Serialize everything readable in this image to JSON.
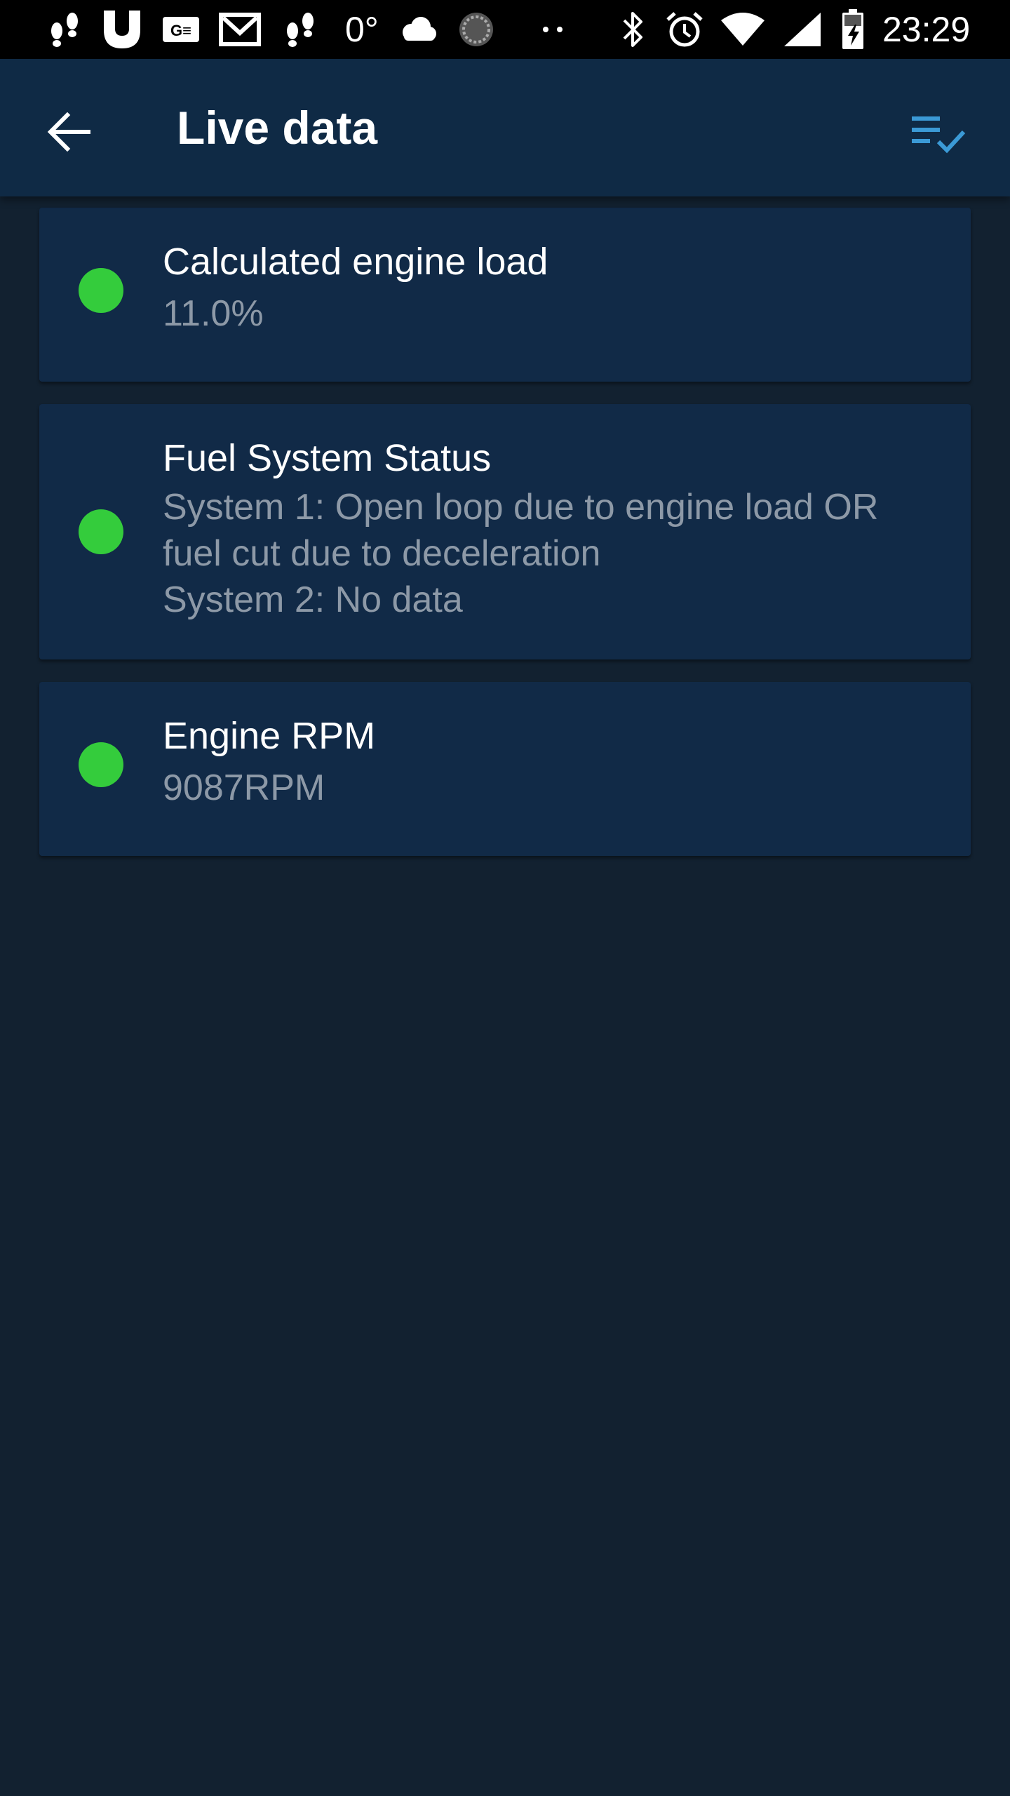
{
  "status_bar": {
    "temperature": "0°",
    "time": "23:29",
    "icons": [
      "footsteps-icon",
      "magnet-icon",
      "ge-icon",
      "gmail-icon",
      "footsteps-icon",
      "cloud-icon",
      "sync-circle-icon",
      "more-dots-icon",
      "bluetooth-icon",
      "alarm-icon",
      "wifi-icon",
      "signal-icon",
      "battery-charging-icon"
    ]
  },
  "app_bar": {
    "title": "Live data",
    "back_icon": "arrow-left-icon",
    "action_icon": "playlist-check-icon",
    "accent_color": "#3b9ad6"
  },
  "items": [
    {
      "title": "Calculated engine load",
      "value": "11.0%",
      "status_color": "#34cc3c"
    },
    {
      "title": "Fuel System Status",
      "value": "System 1: Open loop due to engine load OR\nfuel cut due to deceleration\nSystem 2: No data",
      "status_color": "#34cc3c"
    },
    {
      "title": "Engine RPM",
      "value": "9087RPM",
      "status_color": "#34cc3c"
    }
  ]
}
